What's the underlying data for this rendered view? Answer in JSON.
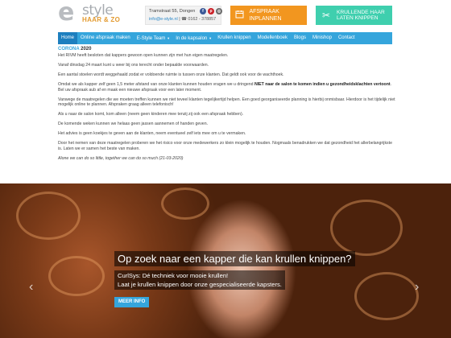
{
  "logo": {
    "mark": "e",
    "brand": "style",
    "tagline": "HAAR & ZO"
  },
  "contact": {
    "address": "Tramstraat 55, Dongen",
    "email": "info@e-style.nl",
    "phone_icon": "☎",
    "phone": "0162 - 378857",
    "social": [
      "facebook-icon",
      "pinterest-icon",
      "instagram-icon"
    ]
  },
  "cta_appointment": {
    "label": "AFSPRAAK INPLANNEN",
    "icon": "calendar-icon"
  },
  "cta_curls": {
    "label_line1": "KRULLENDE HAAR",
    "label_line2": "LATEN KNIPPEN",
    "icon": "scissors-icon"
  },
  "nav": {
    "items": [
      {
        "label": "Home",
        "active": true
      },
      {
        "label": "Online afspraak maken"
      },
      {
        "label": "E-Style Team",
        "caret": "▾"
      },
      {
        "label": "In de kapsalon",
        "caret": "▾"
      },
      {
        "label": "Krullen knippen"
      },
      {
        "label": "Modellenboek"
      },
      {
        "label": "Blogs"
      },
      {
        "label": "Minishop"
      },
      {
        "label": "Contact"
      }
    ]
  },
  "article": {
    "title": "CORONA",
    "year": "2020",
    "p1": "Het RIVM heeft besloten dat kappers gewoon open kunnen zijn met hun eigen maatregelen.",
    "p2": "Vanaf dinsdag 24 maart kunt u weer bij ons terecht onder bepaalde voorwaarden.",
    "p3": "Een aantal stoelen wordt weggehaald zodat er voldoende ruimte is tussen onze klanten. Dat geldt ook voor de wachthoek.",
    "p4_a": "Omdat we als kapper zelf geen 1,5 meter afstand van onze klanten kunnen houden vragen we u dringend ",
    "p4_b": "NIET naar de salon te komen indien u gezondheidsklachten vertoont",
    "p4_c": ". Bel uw afspraak aub af en maak een nieuwe afspraak voor een later moment.",
    "p5": "Vanwege de maatregelen die we moeten treffen kunnen we niet teveel klanten tegelijkertijd helpen.  Een goed georganiseerde planning is hierbij onmisbaar. Hierdoor is het tijdelijk niet mogelijk online te plannen. Afspraken graag alleen telefonisch!",
    "p6": "Als u naar de salon komt, kom alleen (neem geen kinderen mee tenzij zij ook een afspraak hebben).",
    "p7": "De komende weken kunnen we helaas geen jassen aannemen of handen geven.",
    "p8": "Het advies is geen koekjes te geven aan de klanten, neem eventueel zelf iets mee om u te vermaken.",
    "p9": "Door het nemen van deze maatregelen proberen we het risico voor onze medewerkers zo klein mogelijk te houden. Nogmaals benadrukken we dat gezondheid het allerbelangrijkste is. Laten we er samen het beste van maken.",
    "p10": "Alone we can do so little, together we can do so much (21-03-2020)"
  },
  "hero": {
    "title": "Op zoek naar een kapper die kan krullen knippen?",
    "sub_line1": "CurlSys: Dé techniek voor mooie krullen!",
    "sub_line2": "Laat je krullen knippen door onze gespecialiseerde kapsters.",
    "button": "MEER INFO",
    "prev_glyph": "‹",
    "next_glyph": "›"
  }
}
